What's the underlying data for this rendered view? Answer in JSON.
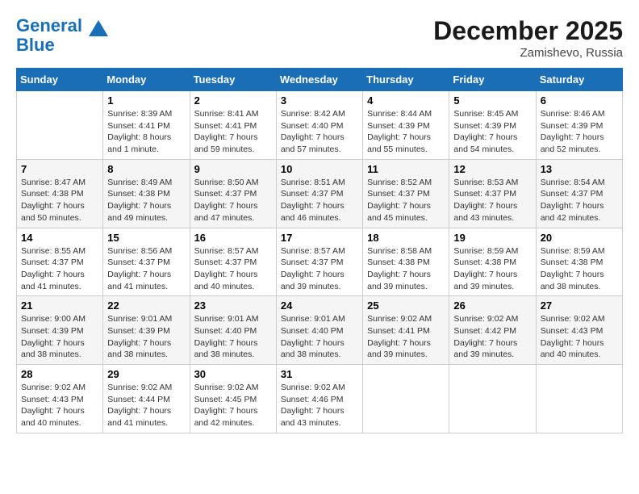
{
  "header": {
    "logo_line1": "General",
    "logo_line2": "Blue",
    "month": "December 2025",
    "location": "Zamishevo, Russia"
  },
  "weekdays": [
    "Sunday",
    "Monday",
    "Tuesday",
    "Wednesday",
    "Thursday",
    "Friday",
    "Saturday"
  ],
  "weeks": [
    [
      {
        "day": "",
        "sunrise": "",
        "sunset": "",
        "daylight": ""
      },
      {
        "day": "1",
        "sunrise": "Sunrise: 8:39 AM",
        "sunset": "Sunset: 4:41 PM",
        "daylight": "Daylight: 8 hours and 1 minute."
      },
      {
        "day": "2",
        "sunrise": "Sunrise: 8:41 AM",
        "sunset": "Sunset: 4:41 PM",
        "daylight": "Daylight: 7 hours and 59 minutes."
      },
      {
        "day": "3",
        "sunrise": "Sunrise: 8:42 AM",
        "sunset": "Sunset: 4:40 PM",
        "daylight": "Daylight: 7 hours and 57 minutes."
      },
      {
        "day": "4",
        "sunrise": "Sunrise: 8:44 AM",
        "sunset": "Sunset: 4:39 PM",
        "daylight": "Daylight: 7 hours and 55 minutes."
      },
      {
        "day": "5",
        "sunrise": "Sunrise: 8:45 AM",
        "sunset": "Sunset: 4:39 PM",
        "daylight": "Daylight: 7 hours and 54 minutes."
      },
      {
        "day": "6",
        "sunrise": "Sunrise: 8:46 AM",
        "sunset": "Sunset: 4:39 PM",
        "daylight": "Daylight: 7 hours and 52 minutes."
      }
    ],
    [
      {
        "day": "7",
        "sunrise": "Sunrise: 8:47 AM",
        "sunset": "Sunset: 4:38 PM",
        "daylight": "Daylight: 7 hours and 50 minutes."
      },
      {
        "day": "8",
        "sunrise": "Sunrise: 8:49 AM",
        "sunset": "Sunset: 4:38 PM",
        "daylight": "Daylight: 7 hours and 49 minutes."
      },
      {
        "day": "9",
        "sunrise": "Sunrise: 8:50 AM",
        "sunset": "Sunset: 4:37 PM",
        "daylight": "Daylight: 7 hours and 47 minutes."
      },
      {
        "day": "10",
        "sunrise": "Sunrise: 8:51 AM",
        "sunset": "Sunset: 4:37 PM",
        "daylight": "Daylight: 7 hours and 46 minutes."
      },
      {
        "day": "11",
        "sunrise": "Sunrise: 8:52 AM",
        "sunset": "Sunset: 4:37 PM",
        "daylight": "Daylight: 7 hours and 45 minutes."
      },
      {
        "day": "12",
        "sunrise": "Sunrise: 8:53 AM",
        "sunset": "Sunset: 4:37 PM",
        "daylight": "Daylight: 7 hours and 43 minutes."
      },
      {
        "day": "13",
        "sunrise": "Sunrise: 8:54 AM",
        "sunset": "Sunset: 4:37 PM",
        "daylight": "Daylight: 7 hours and 42 minutes."
      }
    ],
    [
      {
        "day": "14",
        "sunrise": "Sunrise: 8:55 AM",
        "sunset": "Sunset: 4:37 PM",
        "daylight": "Daylight: 7 hours and 41 minutes."
      },
      {
        "day": "15",
        "sunrise": "Sunrise: 8:56 AM",
        "sunset": "Sunset: 4:37 PM",
        "daylight": "Daylight: 7 hours and 41 minutes."
      },
      {
        "day": "16",
        "sunrise": "Sunrise: 8:57 AM",
        "sunset": "Sunset: 4:37 PM",
        "daylight": "Daylight: 7 hours and 40 minutes."
      },
      {
        "day": "17",
        "sunrise": "Sunrise: 8:57 AM",
        "sunset": "Sunset: 4:37 PM",
        "daylight": "Daylight: 7 hours and 39 minutes."
      },
      {
        "day": "18",
        "sunrise": "Sunrise: 8:58 AM",
        "sunset": "Sunset: 4:38 PM",
        "daylight": "Daylight: 7 hours and 39 minutes."
      },
      {
        "day": "19",
        "sunrise": "Sunrise: 8:59 AM",
        "sunset": "Sunset: 4:38 PM",
        "daylight": "Daylight: 7 hours and 39 minutes."
      },
      {
        "day": "20",
        "sunrise": "Sunrise: 8:59 AM",
        "sunset": "Sunset: 4:38 PM",
        "daylight": "Daylight: 7 hours and 38 minutes."
      }
    ],
    [
      {
        "day": "21",
        "sunrise": "Sunrise: 9:00 AM",
        "sunset": "Sunset: 4:39 PM",
        "daylight": "Daylight: 7 hours and 38 minutes."
      },
      {
        "day": "22",
        "sunrise": "Sunrise: 9:01 AM",
        "sunset": "Sunset: 4:39 PM",
        "daylight": "Daylight: 7 hours and 38 minutes."
      },
      {
        "day": "23",
        "sunrise": "Sunrise: 9:01 AM",
        "sunset": "Sunset: 4:40 PM",
        "daylight": "Daylight: 7 hours and 38 minutes."
      },
      {
        "day": "24",
        "sunrise": "Sunrise: 9:01 AM",
        "sunset": "Sunset: 4:40 PM",
        "daylight": "Daylight: 7 hours and 38 minutes."
      },
      {
        "day": "25",
        "sunrise": "Sunrise: 9:02 AM",
        "sunset": "Sunset: 4:41 PM",
        "daylight": "Daylight: 7 hours and 39 minutes."
      },
      {
        "day": "26",
        "sunrise": "Sunrise: 9:02 AM",
        "sunset": "Sunset: 4:42 PM",
        "daylight": "Daylight: 7 hours and 39 minutes."
      },
      {
        "day": "27",
        "sunrise": "Sunrise: 9:02 AM",
        "sunset": "Sunset: 4:43 PM",
        "daylight": "Daylight: 7 hours and 40 minutes."
      }
    ],
    [
      {
        "day": "28",
        "sunrise": "Sunrise: 9:02 AM",
        "sunset": "Sunset: 4:43 PM",
        "daylight": "Daylight: 7 hours and 40 minutes."
      },
      {
        "day": "29",
        "sunrise": "Sunrise: 9:02 AM",
        "sunset": "Sunset: 4:44 PM",
        "daylight": "Daylight: 7 hours and 41 minutes."
      },
      {
        "day": "30",
        "sunrise": "Sunrise: 9:02 AM",
        "sunset": "Sunset: 4:45 PM",
        "daylight": "Daylight: 7 hours and 42 minutes."
      },
      {
        "day": "31",
        "sunrise": "Sunrise: 9:02 AM",
        "sunset": "Sunset: 4:46 PM",
        "daylight": "Daylight: 7 hours and 43 minutes."
      },
      {
        "day": "",
        "sunrise": "",
        "sunset": "",
        "daylight": ""
      },
      {
        "day": "",
        "sunrise": "",
        "sunset": "",
        "daylight": ""
      },
      {
        "day": "",
        "sunrise": "",
        "sunset": "",
        "daylight": ""
      }
    ]
  ]
}
